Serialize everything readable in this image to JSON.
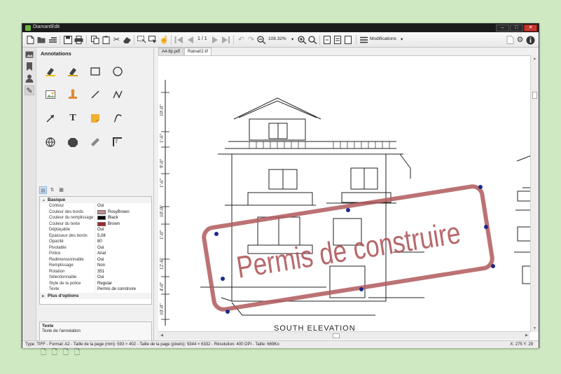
{
  "window": {
    "title": "DiamantEdit",
    "controls": [
      "–",
      "□",
      "✕"
    ]
  },
  "toolbar": {
    "page_current": "1 / 1",
    "zoom": "108.32%",
    "modifications_label": "Modifications",
    "dropdown_arrow": "▾"
  },
  "panel": {
    "title": "Annotations",
    "tool_icons": [
      "highlight-marker-icon",
      "erase-marker-icon",
      "rectangle-icon",
      "ellipse-icon",
      "image-icon",
      "stamp-icon",
      "line-icon",
      "freehand-icon",
      "arrow-icon",
      "text-icon",
      "note-icon",
      "curve-icon",
      "link-icon",
      "polygon-icon",
      "ruler-icon",
      "corner-icon"
    ]
  },
  "properties": {
    "group_basic": "Basique",
    "rows": [
      {
        "name": "Contour",
        "value": "Oui"
      },
      {
        "name": "Couleur des bords",
        "value": "RosyBrown",
        "color": "#bc8f8f"
      },
      {
        "name": "Couleur du remplissage",
        "value": "Black",
        "color": "#000000"
      },
      {
        "name": "Couleur du texte",
        "value": "Brown",
        "color": "#a52a2a"
      },
      {
        "name": "Déplaçable",
        "value": "Oui"
      },
      {
        "name": "Epaisseur des bords",
        "value": "5,08"
      },
      {
        "name": "Opacité",
        "value": "80"
      },
      {
        "name": "Pivotable",
        "value": "Oui"
      },
      {
        "name": "Police",
        "value": "Arial"
      },
      {
        "name": "Redimensionnable",
        "value": "Oui"
      },
      {
        "name": "Remplissage",
        "value": "Non"
      },
      {
        "name": "Rotation",
        "value": "351"
      },
      {
        "name": "Sélectionnable",
        "value": "Oui"
      },
      {
        "name": "Style de la police",
        "value": "Regular"
      },
      {
        "name": "Texte",
        "value": "Permis de construire"
      }
    ],
    "group_more": "Plus d'options"
  },
  "description": {
    "title": "Texte",
    "text": "Texte de l'annotation"
  },
  "tabs": [
    {
      "label": "A4-8p.pdf",
      "active": false
    },
    {
      "label": "Ratna02.tif",
      "active": true
    }
  ],
  "document": {
    "drawing_caption": "SOUTH ELEVATION",
    "stamp_text": "Permis de construire",
    "stamp_color": "#b0595c",
    "dimension_labels": [
      "10'-0\"",
      "9'-0\"",
      "1'-6\"",
      "10'-0\"",
      "1'-6\"",
      "10'-0\"",
      "1'-0\"",
      "12'-6\"",
      "4'-0\""
    ]
  },
  "status": {
    "text": "Type: TIFF  -  Format: A2  -  Taille de la page (mm): 593 × 402  -  Taille de la page (pixels): 9344 × 6332  -  Résolution: 400 DPI  -  Taille: 669Ko",
    "coords": "X: 275 Y: 29"
  },
  "colors": {
    "accent_green": "#6db13a",
    "background": "#cfeac3"
  }
}
